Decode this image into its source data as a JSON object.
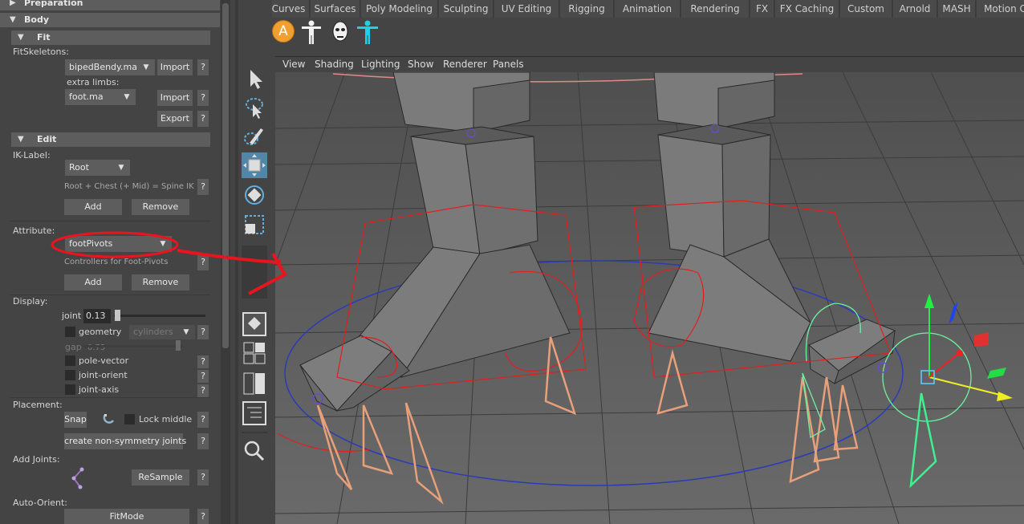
{
  "panel": {
    "preparation_header": "Preparation",
    "body_header": "Body",
    "fit": {
      "header": "Fit",
      "fit_skeletons_label": "FitSkeletons:",
      "skeleton_select": "bipedBendy.ma",
      "import_label": "Import",
      "help_label": "?",
      "extra_limbs_label": "extra limbs:",
      "extra_limbs_select": "foot.ma",
      "import2_label": "Import",
      "export_label": "Export"
    },
    "edit": {
      "header": "Edit",
      "ik_label": "IK-Label:",
      "ik_select": "Root",
      "ik_hint": "Root + Chest (+ Mid) = Spine IK",
      "add_label": "Add",
      "remove_label": "Remove",
      "attribute_label": "Attribute:",
      "attribute_select": "footPivots",
      "attribute_hint": "Controllers for Foot-Pivots",
      "add2_label": "Add",
      "remove2_label": "Remove"
    },
    "display": {
      "label": "Display:",
      "joint_label": "joint",
      "joint_value": "0.13",
      "joint_slider_fraction": 0.13,
      "geometry_label": "geometry",
      "geometry_select": "cylinders",
      "gap_label": "gap",
      "gap_value": "0.75",
      "gap_slider_fraction": 0.75,
      "pole_vector_label": "pole-vector",
      "joint_orient_label": "joint-orient",
      "joint_axis_label": "joint-axis"
    },
    "placement": {
      "label": "Placement:",
      "snap_label": "Snap",
      "lock_middle_label": "Lock middle",
      "non_symmetry_label": "create non-symmetry joints"
    },
    "add_joints": {
      "label": "Add Joints:",
      "resample_label": "ReSample"
    },
    "auto_orient": {
      "label": "Auto-Orient:",
      "fitmode_label": "FitMode"
    }
  },
  "shelf": {
    "tabs": [
      "Curves",
      "Surfaces",
      "Poly Modeling",
      "Sculpting",
      "UV Editing",
      "Rigging",
      "Animation",
      "Rendering",
      "FX",
      "FX Caching",
      "Custom",
      "Arnold",
      "MASH",
      "Motion C"
    ],
    "asset_icon_letter": "A"
  },
  "viewport": {
    "menu": [
      "View",
      "Shading",
      "Lighting",
      "Show",
      "Renderer",
      "Panels"
    ]
  },
  "colors": {
    "panel_bg": "#444444",
    "button_bg": "#5d5d5d",
    "active_tool": "#5285a6",
    "viewport_bg": "#5b5b5b",
    "annotation_red": "#e8141e"
  }
}
